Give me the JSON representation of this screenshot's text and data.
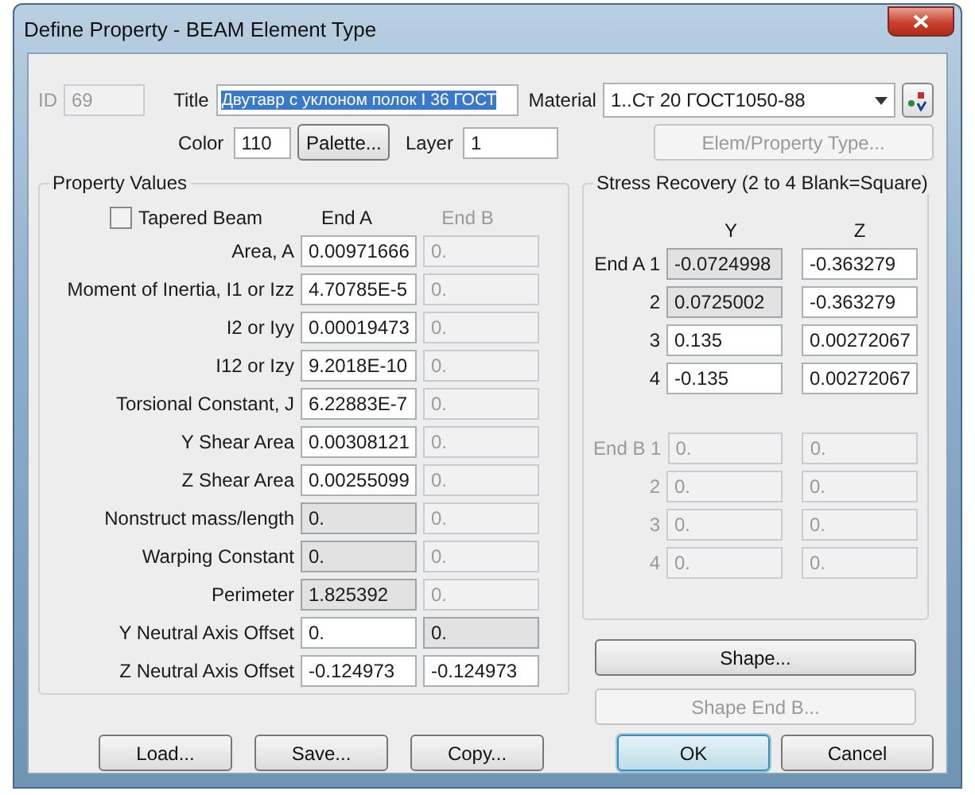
{
  "window": {
    "title": "Define Property - BEAM Element Type"
  },
  "header": {
    "id_label": "ID",
    "id_value": "69",
    "title_label": "Title",
    "title_value": "Двутавр с уклоном полок I 36 ГОСТ",
    "title_selected": true,
    "material_label": "Material",
    "material_value": "1..Ст 20  ГОСТ1050-88",
    "color_label": "Color",
    "color_value": "110",
    "palette_button": "Palette...",
    "layer_label": "Layer",
    "layer_value": "1",
    "elem_type_button": {
      "label": "Elem/Property Type...",
      "disabled": true
    }
  },
  "property_values": {
    "title": "Property Values",
    "tapered_beam": {
      "label": "Tapered Beam",
      "checked": false
    },
    "end_a_header": "End A",
    "end_b_header": {
      "label": "End B",
      "disabled": true
    },
    "rows": [
      {
        "label": "Area,  A",
        "end_a": {
          "value": "0.00971666",
          "readonly": false,
          "disabled": false
        },
        "end_b": {
          "value": "0.",
          "readonly": false,
          "disabled": true
        }
      },
      {
        "label": "Moment of Inertia,  I1 or Izz",
        "end_a": {
          "value": "4.70785E-5",
          "readonly": false,
          "disabled": false
        },
        "end_b": {
          "value": "0.",
          "readonly": false,
          "disabled": true
        }
      },
      {
        "label": "I2 or Iyy",
        "end_a": {
          "value": "0.00019473",
          "readonly": false,
          "disabled": false
        },
        "end_b": {
          "value": "0.",
          "readonly": false,
          "disabled": true
        }
      },
      {
        "label": "I12 or Izy",
        "end_a": {
          "value": "9.2018E-10",
          "readonly": false,
          "disabled": false
        },
        "end_b": {
          "value": "0.",
          "readonly": false,
          "disabled": true
        }
      },
      {
        "label": "Torsional Constant,  J",
        "end_a": {
          "value": "6.22883E-7",
          "readonly": false,
          "disabled": false
        },
        "end_b": {
          "value": "0.",
          "readonly": false,
          "disabled": true
        }
      },
      {
        "label": "Y Shear Area",
        "end_a": {
          "value": "0.00308121",
          "readonly": false,
          "disabled": false
        },
        "end_b": {
          "value": "0.",
          "readonly": false,
          "disabled": true
        }
      },
      {
        "label": "Z Shear Area",
        "end_a": {
          "value": "0.00255099",
          "readonly": false,
          "disabled": false
        },
        "end_b": {
          "value": "0.",
          "readonly": false,
          "disabled": true
        }
      },
      {
        "label": "Nonstruct mass/length",
        "end_a": {
          "value": "0.",
          "readonly": true,
          "disabled": false
        },
        "end_b": {
          "value": "0.",
          "readonly": false,
          "disabled": true
        }
      },
      {
        "label": "Warping Constant",
        "end_a": {
          "value": "0.",
          "readonly": true,
          "disabled": false
        },
        "end_b": {
          "value": "0.",
          "readonly": false,
          "disabled": true
        }
      },
      {
        "label": "Perimeter",
        "end_a": {
          "value": "1.825392",
          "readonly": true,
          "disabled": false
        },
        "end_b": {
          "value": "0.",
          "readonly": false,
          "disabled": true
        }
      },
      {
        "label": "Y Neutral Axis Offset",
        "end_a": {
          "value": "0.",
          "readonly": false,
          "disabled": false
        },
        "end_b": {
          "value": "0.",
          "readonly": true,
          "disabled": false
        }
      },
      {
        "label": "Z Neutral Axis Offset",
        "end_a": {
          "value": "-0.124973",
          "readonly": false,
          "disabled": false
        },
        "end_b": {
          "value": "-0.124973",
          "readonly": false,
          "disabled": false
        }
      }
    ]
  },
  "stress_recovery": {
    "title": "Stress Recovery (2 to 4 Blank=Square)",
    "y_header": "Y",
    "z_header": "Z",
    "end_a": [
      {
        "label": "End A 1",
        "disabled": false,
        "y": {
          "value": "-0.0724998",
          "readonly": true,
          "disabled": false
        },
        "z": {
          "value": "-0.363279",
          "readonly": false,
          "disabled": false
        }
      },
      {
        "label": "2",
        "disabled": false,
        "y": {
          "value": "0.0725002",
          "readonly": true,
          "disabled": false
        },
        "z": {
          "value": "-0.363279",
          "readonly": false,
          "disabled": false
        }
      },
      {
        "label": "3",
        "disabled": false,
        "y": {
          "value": "0.135",
          "readonly": false,
          "disabled": false
        },
        "z": {
          "value": "0.00272067",
          "readonly": false,
          "disabled": false
        }
      },
      {
        "label": "4",
        "disabled": false,
        "y": {
          "value": "-0.135",
          "readonly": false,
          "disabled": false
        },
        "z": {
          "value": "0.00272067",
          "readonly": false,
          "disabled": false
        }
      }
    ],
    "end_b": [
      {
        "label": "End B 1",
        "disabled": true,
        "y": {
          "value": "0.",
          "readonly": false,
          "disabled": true
        },
        "z": {
          "value": "0.",
          "readonly": false,
          "disabled": true
        }
      },
      {
        "label": "2",
        "disabled": true,
        "y": {
          "value": "0.",
          "readonly": false,
          "disabled": true
        },
        "z": {
          "value": "0.",
          "readonly": false,
          "disabled": true
        }
      },
      {
        "label": "3",
        "disabled": true,
        "y": {
          "value": "0.",
          "readonly": false,
          "disabled": true
        },
        "z": {
          "value": "0.",
          "readonly": false,
          "disabled": true
        }
      },
      {
        "label": "4",
        "disabled": true,
        "y": {
          "value": "0.",
          "readonly": false,
          "disabled": true
        },
        "z": {
          "value": "0.",
          "readonly": false,
          "disabled": true
        }
      }
    ]
  },
  "side_buttons": [
    {
      "label": "Shape...",
      "disabled": false
    },
    {
      "label": "Shape End B...",
      "disabled": true
    }
  ],
  "bottom_buttons": [
    {
      "label": "Load...",
      "default": false
    },
    {
      "label": "Save...",
      "default": false
    },
    {
      "label": "Copy...",
      "default": false
    }
  ],
  "dialog_buttons": [
    {
      "label": "OK",
      "default": true
    },
    {
      "label": "Cancel",
      "default": false
    }
  ]
}
